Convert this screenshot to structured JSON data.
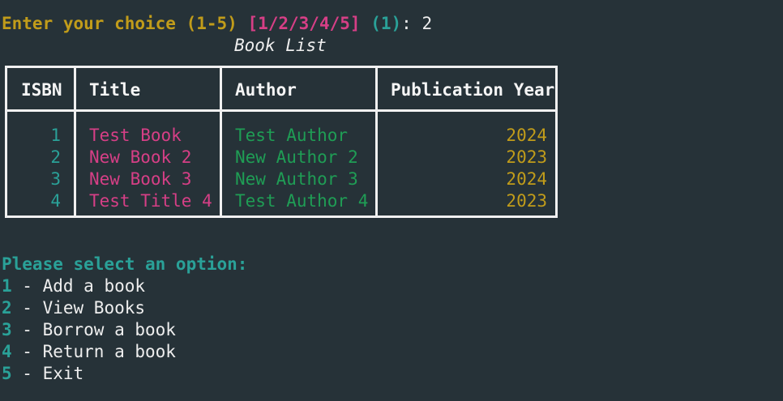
{
  "prompt": {
    "label": "Enter your choice (1-5)",
    "options": "[1/2/3/4/5]",
    "default": "(1)",
    "separator": ":",
    "input": "2"
  },
  "table": {
    "title": "Book List",
    "columns": [
      "ISBN",
      "Title",
      "Author",
      "Publication Year"
    ],
    "rows": [
      {
        "isbn": "1",
        "title": "Test Book",
        "author": "Test Author",
        "year": "2024"
      },
      {
        "isbn": "2",
        "title": "New Book 2",
        "author": "New Author 2",
        "year": "2023"
      },
      {
        "isbn": "3",
        "title": "New Book 3",
        "author": "New Author 3",
        "year": "2024"
      },
      {
        "isbn": "4",
        "title": "Test Title 4",
        "author": "Test Author 4",
        "year": "2023"
      }
    ]
  },
  "menu": {
    "heading": "Please select an option:",
    "items": [
      {
        "key": "1",
        "label": " - Add a book"
      },
      {
        "key": "2",
        "label": " - View Books"
      },
      {
        "key": "3",
        "label": " - Borrow a book"
      },
      {
        "key": "4",
        "label": " - Return a book"
      },
      {
        "key": "5",
        "label": " - Exit"
      }
    ]
  },
  "colors": {
    "background": "#263238",
    "prompt": "#c19c1a",
    "options": "#d63f86",
    "default": "#2aa198",
    "isbn": "#2aa198",
    "title": "#d63f86",
    "author": "#1f9d55",
    "year": "#c19c1a",
    "border": "#f0f0f0"
  }
}
